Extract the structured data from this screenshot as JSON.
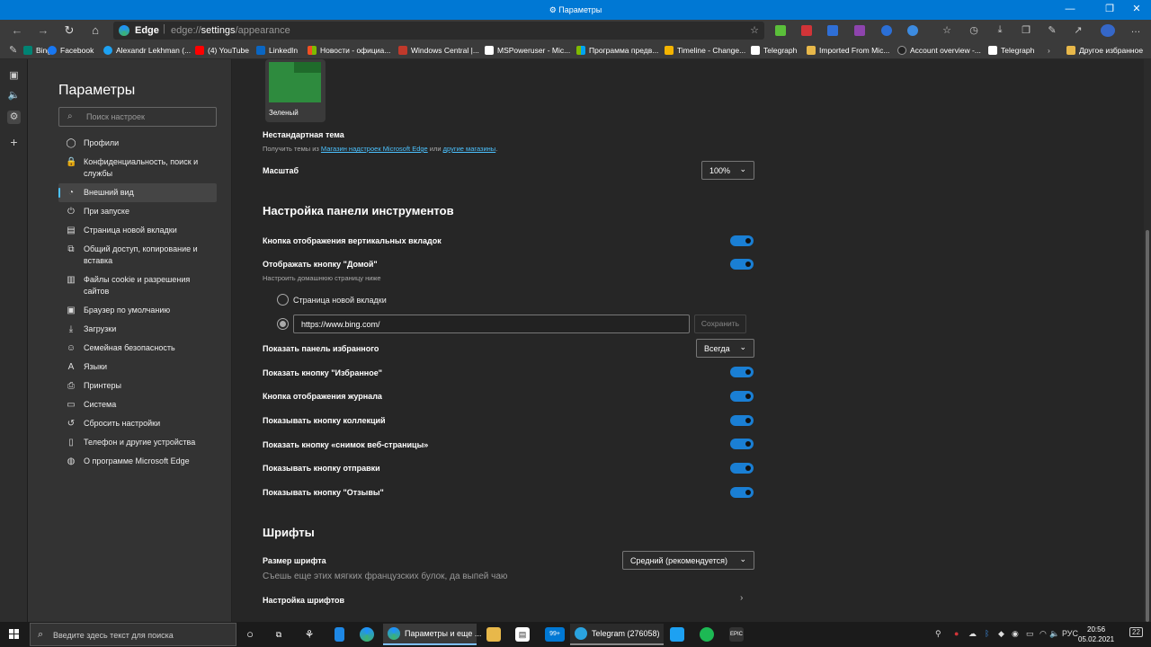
{
  "window": {
    "title": "Параметры"
  },
  "address": {
    "brand": "Edge",
    "url_prefix": "edge://",
    "url_host": "settings",
    "url_path": "/appearance"
  },
  "favorites": [
    {
      "label": "Bing",
      "color": "#008373"
    },
    {
      "label": "Facebook",
      "color": "#1877f2"
    },
    {
      "label": "Alexandr Lekhman (...",
      "color": "#1da1f2"
    },
    {
      "label": "(4) YouTube",
      "color": "#ff0000"
    },
    {
      "label": "LinkedIn",
      "color": "#0a66c2"
    },
    {
      "label": "Новости - официа...",
      "color": "#f25022"
    },
    {
      "label": "Windows Central |...",
      "color": "#c0392b"
    },
    {
      "label": "MSPoweruser - Mic...",
      "color": "#ffffff"
    },
    {
      "label": "Программа предв...",
      "color": "#7fba00"
    },
    {
      "label": "Timeline - Change...",
      "color": "#f4b400"
    },
    {
      "label": "Telegraph",
      "color": "#ffffff"
    },
    {
      "label": "Imported From Mic...",
      "color": "#e8b84a"
    },
    {
      "label": "Account overview -...",
      "color": "#222222"
    },
    {
      "label": "Telegraph",
      "color": "#ffffff"
    }
  ],
  "favorites_other": "Другое избранное",
  "sidebar": {
    "title": "Параметры",
    "search_placeholder": "Поиск настроек",
    "items": [
      {
        "label": "Профили",
        "icon": "person-icon"
      },
      {
        "label": "Конфиденциальность, поиск и службы",
        "icon": "lock-icon"
      },
      {
        "label": "Внешний вид",
        "icon": "palette-icon",
        "active": true
      },
      {
        "label": "При запуске",
        "icon": "power-icon"
      },
      {
        "label": "Страница новой вкладки",
        "icon": "new-tab-icon"
      },
      {
        "label": "Общий доступ, копирование и вставка",
        "icon": "share-icon"
      },
      {
        "label": "Файлы cookie и разрешения сайтов",
        "icon": "cookie-icon"
      },
      {
        "label": "Браузер по умолчанию",
        "icon": "browser-icon"
      },
      {
        "label": "Загрузки",
        "icon": "download-icon"
      },
      {
        "label": "Семейная безопасность",
        "icon": "family-icon"
      },
      {
        "label": "Языки",
        "icon": "language-icon"
      },
      {
        "label": "Принтеры",
        "icon": "printer-icon"
      },
      {
        "label": "Система",
        "icon": "system-icon"
      },
      {
        "label": "Сбросить настройки",
        "icon": "reset-icon"
      },
      {
        "label": "Телефон и другие устройства",
        "icon": "phone-icon"
      },
      {
        "label": "О программе Microsoft Edge",
        "icon": "edge-icon"
      }
    ]
  },
  "main": {
    "theme_label": "Зеленый",
    "custom_theme": {
      "title": "Нестандартная тема",
      "desc_before": "Получить темы из ",
      "link1": "Магазин надстроек Microsoft Edge",
      "desc_mid": " или ",
      "link2": "другие магазины",
      "desc_after": "."
    },
    "zoom": {
      "label": "Масштаб",
      "value": "100%"
    },
    "toolbar_heading": "Настройка панели инструментов",
    "vertical_tabs": "Кнопка отображения вертикальных вкладок",
    "home_button": "Отображать кнопку \"Домой\"",
    "home_desc": "Настроить домашнюю страницу ниже",
    "radio_newtab": "Страница новой вкладки",
    "home_url": "https://www.bing.com/",
    "save": "Сохранить",
    "fav_bar": {
      "label": "Показать панель избранного",
      "value": "Всегда"
    },
    "toggles": [
      {
        "label": "Показать кнопку \"Избранное\"",
        "on": true
      },
      {
        "label": "Кнопка отображения журнала",
        "on": true
      },
      {
        "label": "Показывать кнопку коллекций",
        "on": true
      },
      {
        "label": "Показать кнопку «снимок веб-страницы»",
        "on": true
      },
      {
        "label": "Показывать кнопку отправки",
        "on": true
      },
      {
        "label": "Показывать кнопку \"Отзывы\"",
        "on": true
      }
    ],
    "fonts_heading": "Шрифты",
    "font_size": {
      "label": "Размер шрифта",
      "value": "Средний (рекомендуется)",
      "sample": "Съешь еще этих мягких французских булок, да выпей чаю"
    },
    "font_settings": "Настройка шрифтов"
  },
  "taskbar": {
    "search_placeholder": "Введите здесь текст для поиска",
    "active_app": "Параметры и еще ...",
    "telegram_app": "Telegram (276058)",
    "mail_badge": "99+",
    "lang": "РУС",
    "time": "20:56",
    "date": "05.02.2021",
    "notif": "22"
  },
  "colors": {
    "accent": "#0078d4",
    "toggle_on": "#1a7fd4",
    "link": "#4cc2ff"
  }
}
